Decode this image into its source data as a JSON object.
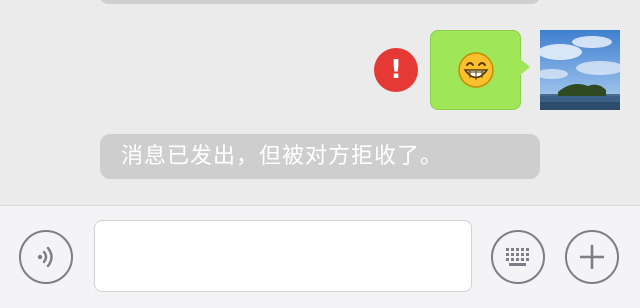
{
  "chat": {
    "error_mark": "!",
    "sent_message": {
      "emoji": "grinning-face-emoji",
      "bubble_color": "#9fe658"
    },
    "avatar": "landscape-photo",
    "notice": "消息已发出，但被对方拒收了。"
  },
  "input_bar": {
    "text_value": "",
    "icons": [
      "voice-icon",
      "keyboard-icon",
      "plus-icon"
    ]
  },
  "colors": {
    "error": "#e53935",
    "bubble": "#9fe658",
    "notice_bg": "#cecece",
    "chat_bg": "#ebebeb"
  }
}
